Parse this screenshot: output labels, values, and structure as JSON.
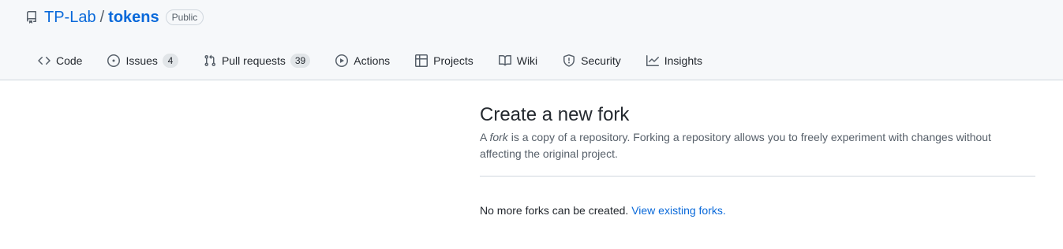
{
  "repo": {
    "owner": "TP-Lab",
    "separator": "/",
    "name": "tokens",
    "visibility": "Public"
  },
  "tabs": [
    {
      "label": "Code",
      "icon": "code-icon"
    },
    {
      "label": "Issues",
      "icon": "issue-icon",
      "counter": "4"
    },
    {
      "label": "Pull requests",
      "icon": "pull-request-icon",
      "counter": "39"
    },
    {
      "label": "Actions",
      "icon": "play-icon"
    },
    {
      "label": "Projects",
      "icon": "table-icon"
    },
    {
      "label": "Wiki",
      "icon": "book-icon"
    },
    {
      "label": "Security",
      "icon": "shield-icon"
    },
    {
      "label": "Insights",
      "icon": "graph-icon"
    }
  ],
  "fork": {
    "title": "Create a new fork",
    "desc_prefix": "A ",
    "desc_em": "fork",
    "desc_suffix": " is a copy of a repository. Forking a repository allows you to freely experiment with changes without affecting the original project.",
    "message": "No more forks can be created.",
    "link_text": "View existing forks."
  },
  "colors": {
    "accent": "#0969da",
    "header_bg": "#f6f8fa",
    "border": "#d0d7de",
    "muted": "#57606a"
  }
}
